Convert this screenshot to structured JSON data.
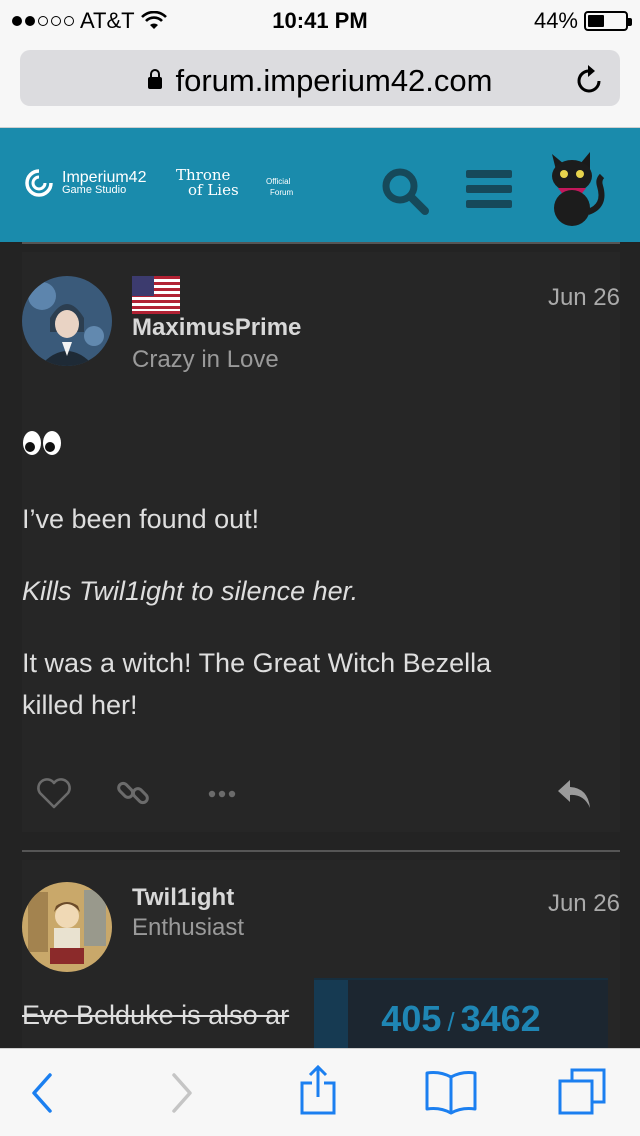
{
  "status_bar": {
    "carrier": "AT&T",
    "time": "10:41 PM",
    "battery_pct": "44%",
    "battery_level": 0.44,
    "signal_bars": 2
  },
  "browser": {
    "url": "forum.imperium42.com"
  },
  "header": {
    "brand_name": "Imperium42",
    "brand_sub": "Game Studio",
    "game_logo_line1": "Throne",
    "game_logo_line2": "of Lies",
    "game_logo_sub1": "Official",
    "game_logo_sub2": "Forum",
    "accent": "#1a8bac"
  },
  "posts": [
    {
      "username": "MaximusPrime",
      "user_title": "Crazy in Love",
      "date": "Jun 26",
      "emoji": "👀",
      "paragraphs": [
        "I’ve been found out!",
        "Kills Twil1ight to silence her.",
        "It was a witch! The Great Witch Bezella",
        "killed her!"
      ]
    },
    {
      "username": "Twil1ight",
      "user_title": "Enthusiast",
      "date": "Jun 26",
      "paragraphs": [
        "Eve Belduke is also ar"
      ]
    }
  ],
  "progress": {
    "current": "405",
    "separator": "/",
    "total": "3462"
  }
}
